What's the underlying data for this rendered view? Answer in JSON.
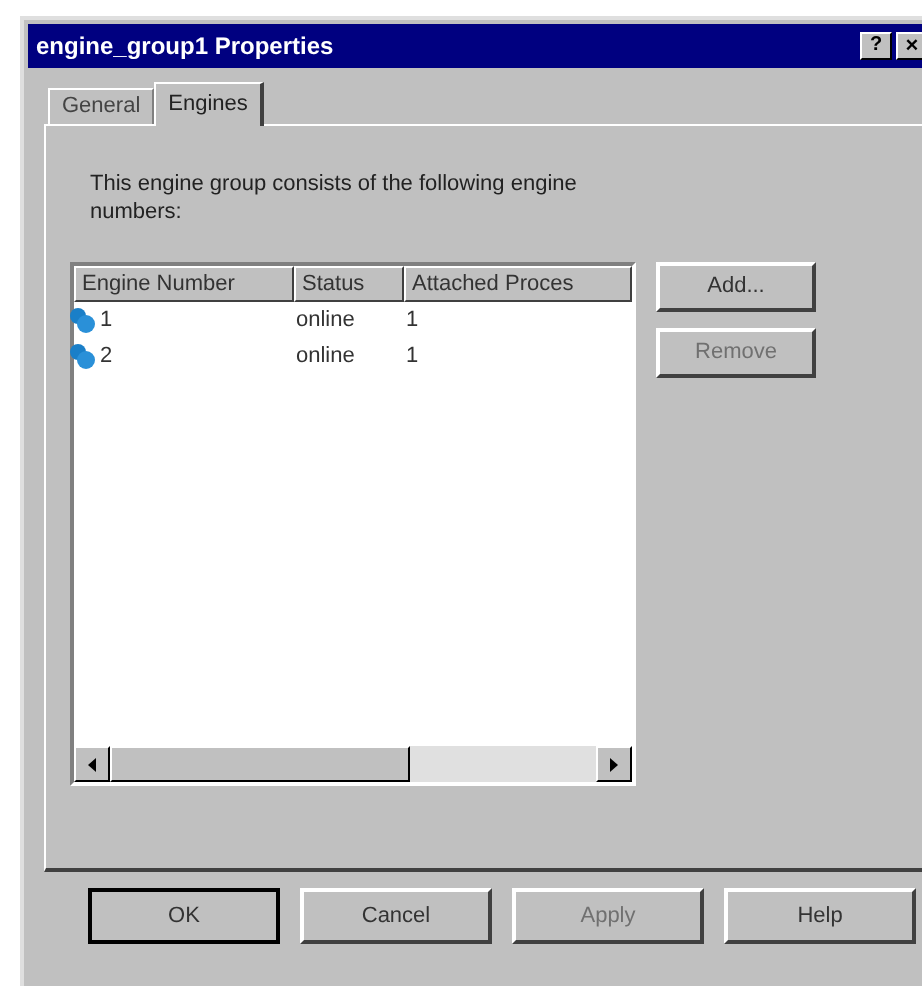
{
  "window": {
    "title": "engine_group1 Properties",
    "help": "?",
    "close": "×"
  },
  "tabs": [
    {
      "label": "General",
      "selected": false
    },
    {
      "label": "Engines",
      "selected": true
    }
  ],
  "description": "This engine group consists of the following engine numbers:",
  "table": {
    "columns": [
      "Engine Number",
      "Status",
      "Attached Proces"
    ],
    "rows": [
      {
        "cells": [
          "1",
          "online",
          "1"
        ]
      },
      {
        "cells": [
          "2",
          "online",
          "1"
        ]
      }
    ]
  },
  "side_buttons": [
    {
      "label": "Add...",
      "disabled": false
    },
    {
      "label": "Remove",
      "disabled": true
    }
  ],
  "buttons": [
    {
      "label": "OK",
      "disabled": false,
      "default": true
    },
    {
      "label": "Cancel",
      "disabled": false,
      "default": false
    },
    {
      "label": "Apply",
      "disabled": true,
      "default": false
    },
    {
      "label": "Help",
      "disabled": false,
      "default": false
    }
  ]
}
